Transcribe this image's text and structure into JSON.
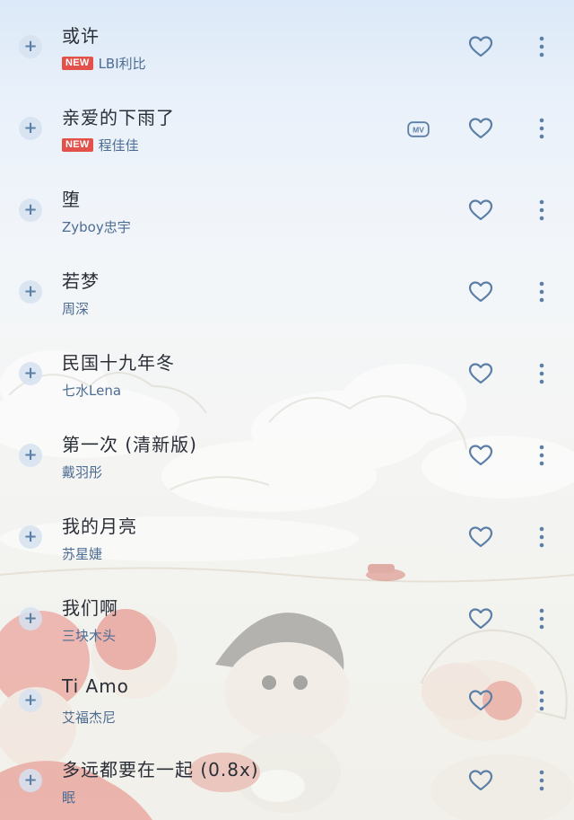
{
  "songs": [
    {
      "title": "或许",
      "badge": "NEW",
      "artist": "LBI利比",
      "mv": false
    },
    {
      "title": "亲爱的下雨了",
      "badge": "NEW",
      "artist": "程佳佳",
      "mv": true
    },
    {
      "title": "堕",
      "badge": "",
      "artist": "Zyboy忠宇",
      "mv": false
    },
    {
      "title": "若梦",
      "badge": "",
      "artist": "周深",
      "mv": false
    },
    {
      "title": "民国十九年冬",
      "badge": "",
      "artist": "七水Lena",
      "mv": false
    },
    {
      "title": "第一次 (清新版)",
      "badge": "",
      "artist": "戴羽彤",
      "mv": false
    },
    {
      "title": "我的月亮",
      "badge": "",
      "artist": "苏星婕",
      "mv": false
    },
    {
      "title": "我们啊",
      "badge": "",
      "artist": "三块木头",
      "mv": false
    },
    {
      "title": "Ti Amo",
      "badge": "",
      "artist": "艾福杰尼",
      "mv": false
    },
    {
      "title": "多远都要在一起 (0.8x)",
      "badge": "",
      "artist": "眠",
      "mv": false
    }
  ],
  "icons": {
    "add": "plus-icon",
    "mv": "mv-icon",
    "favorite": "heart-icon",
    "more": "more-vertical-icon"
  },
  "mv_label": "MV",
  "colors": {
    "title": "#2a2e36",
    "artist": "#4d6c92",
    "badge": "#e2524b",
    "icon": "#5b7fa6"
  }
}
